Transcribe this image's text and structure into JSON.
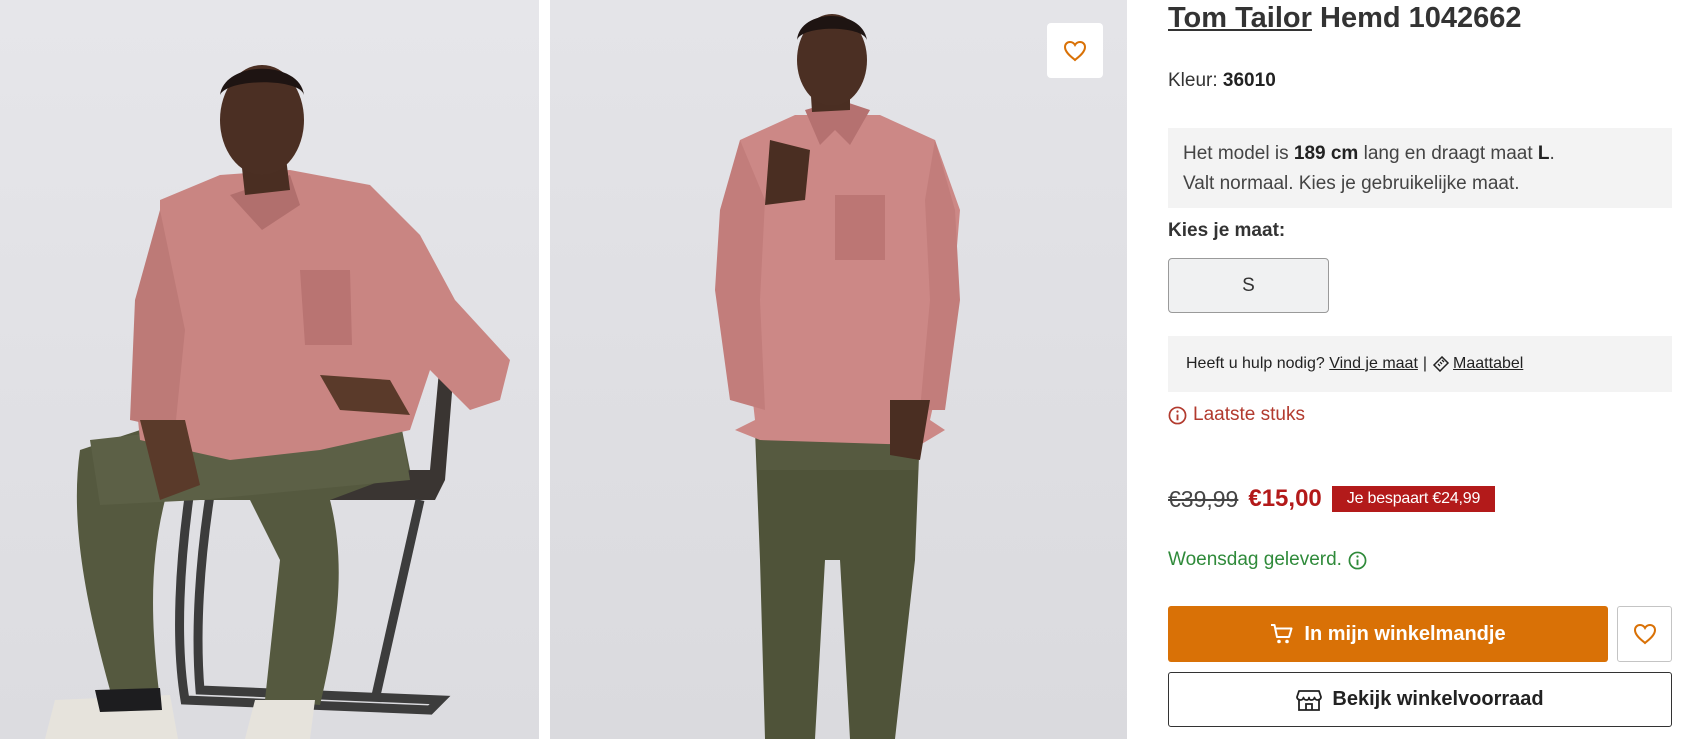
{
  "product": {
    "brand": "Tom Tailor",
    "name": "Hemd 1042662",
    "color_label": "Kleur:",
    "color_value": "36010"
  },
  "model_info": {
    "part1": "Het model is ",
    "height": "189 cm",
    "part2": " lang en draagt maat ",
    "size": "L",
    "part3": ".",
    "fit_text": "Valt normaal. Kies je gebruikelijke maat."
  },
  "size_selector": {
    "label": "Kies je maat:",
    "options": [
      "S"
    ]
  },
  "help": {
    "question": "Heeft u hulp nodig?",
    "find_size_link": "Vind je maat",
    "separator": "|",
    "size_chart_link": "Maattabel"
  },
  "stock": {
    "text": "Laatste stuks"
  },
  "price": {
    "old": "€39,99",
    "new": "€15,00",
    "savings": "Je bespaart €24,99"
  },
  "delivery": {
    "text": "Woensdag geleverd."
  },
  "actions": {
    "add_to_cart": "In mijn winkelmandje",
    "check_store": "Bekijk winkelvoorraad"
  },
  "colors": {
    "accent_orange": "#d97106",
    "sale_red": "#b31a1a",
    "stock_red": "#b23a2e",
    "delivery_green": "#2f8a3a"
  },
  "icons": {
    "wishlist": "heart-icon",
    "stock": "info-icon",
    "delivery": "info-icon",
    "cart": "cart-icon",
    "store": "store-icon",
    "size_chart": "ruler-icon"
  }
}
